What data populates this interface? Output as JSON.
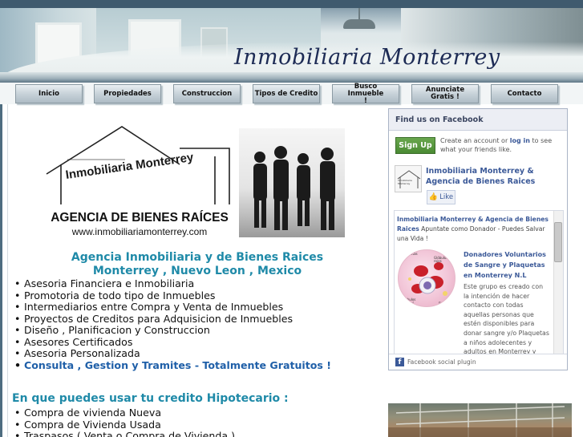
{
  "site": {
    "title": "Inmobiliaria Monterrey"
  },
  "nav": {
    "items": [
      {
        "label": "Inicio"
      },
      {
        "label": "Propiedades"
      },
      {
        "label": "Construccion"
      },
      {
        "label": "Tipos de Credito"
      },
      {
        "label": "Busco Inmueble !"
      },
      {
        "label": "Anunciate Gratis !"
      },
      {
        "label": "Contacto"
      }
    ]
  },
  "logo": {
    "brand": "Inmobiliaria Monterrey",
    "agency": "AGENCIA DE BIENES RAÍCES",
    "url": "www.inmobiliariamonterrey.com"
  },
  "main": {
    "headline1": "Agencia Inmobiliaria y de Bienes Raices",
    "headline2": "Monterrey , Nuevo Leon , Mexico",
    "services": [
      "Asesoria Financiera e Inmobiliaria",
      "Promotoria de todo tipo de Inmuebles",
      "Intermediarios entre Compra y Venta de Inmuebles",
      "Proyectos de Creditos para Adquisicion de Inmuebles",
      "Diseño , Planificacion y Construccion",
      "Asesores Certificados",
      "Asesoria Personalizada",
      "Consulta , Gestion y Tramites - Totalmente Gratuitos !"
    ],
    "credit_heading": "En que puedes usar tu credito Hipotecario :",
    "credit_uses": [
      "Compra de vivienda Nueva",
      "Compra de Vivienda Usada",
      "Traspasos ( Venta o Compra de Vivienda )"
    ]
  },
  "facebook": {
    "header": "Find us on Facebook",
    "signup": "Sign Up",
    "signup_text_pre": "Create an account or",
    "signup_link": "log in",
    "signup_text_post": "to see what your friends like.",
    "thumb_label": "Inmobiliaria Monterrey",
    "page_name": "Inmobiliaria Monterrey & Agencia de Bienes Raices",
    "like": "Like",
    "post1_author": "Inmobiliaria Monterrey & Agencia de Bienes Raices",
    "post1_text": "Apuntate como Donador - Puedes Salvar una Vida !",
    "blood_labels": [
      "Plaquetas",
      "Glóbulos rojos",
      "Glóbulos blancos",
      "Plasma"
    ],
    "post2_title": "Donadores Voluntarios de Sangre y Plaquetas en Monterrey N.L",
    "post2_body": "Este grupo es creado con la intención de hacer contacto con todas aquellas personas que estén disponibles para donar sangre y/o Plaquetas a niños adolecentes y adultos en Monterrey y",
    "footer": "Facebook social plugin"
  },
  "colors": {
    "headline": "#1f8aa8",
    "highlight": "#1f5fa8",
    "title": "#1d2b55",
    "facebook": "#3b5998"
  }
}
